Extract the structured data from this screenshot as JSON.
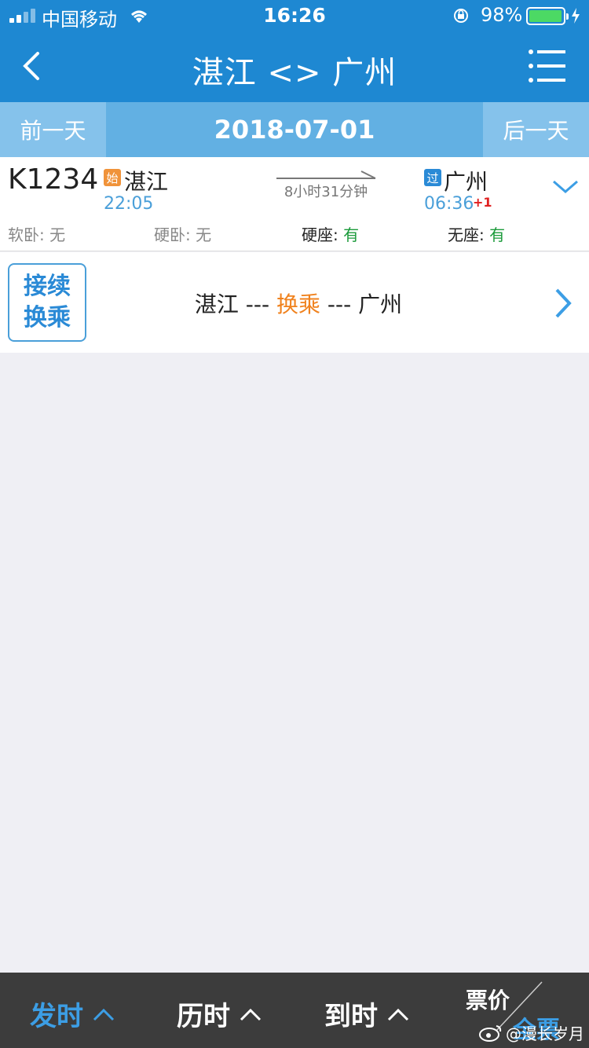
{
  "status_bar": {
    "carrier": "中国移动",
    "time": "16:26",
    "battery": "98%",
    "battery_level": 0.98
  },
  "nav": {
    "title": "湛江 <> 广州"
  },
  "date_bar": {
    "prev_label": "前一天",
    "date": "2018-07-01",
    "next_label": "后一天"
  },
  "train": {
    "number": "K1234",
    "from_badge": "始",
    "from_station": "湛江",
    "dep_time": "22:05",
    "duration": "8小时31分钟",
    "to_badge": "过",
    "to_station": "广州",
    "arr_time": "06:36",
    "day_offset": "+1",
    "seats": [
      {
        "label": "软卧",
        "value": "无"
      },
      {
        "label": "硬卧",
        "value": "无"
      },
      {
        "label": "硬座",
        "value": "有"
      },
      {
        "label": "无座",
        "value": "有"
      }
    ]
  },
  "transfer": {
    "tag_line1": "接续",
    "tag_line2": "换乘",
    "from": "湛江",
    "sep_left": " --- ",
    "middle": "换乘",
    "sep_right": " --- ",
    "to": "广州"
  },
  "toolbar": {
    "sort_dep": "发时",
    "sort_dur": "历时",
    "sort_arr": "到时",
    "price_label": "票价",
    "price_all": "全票",
    "watermark": "@漫长岁月"
  },
  "colors": {
    "nav_blue": "#1e88d2",
    "date_blue": "#62b0e3",
    "accent_orange": "#f0821e",
    "available_green": "#1a9a3a"
  }
}
